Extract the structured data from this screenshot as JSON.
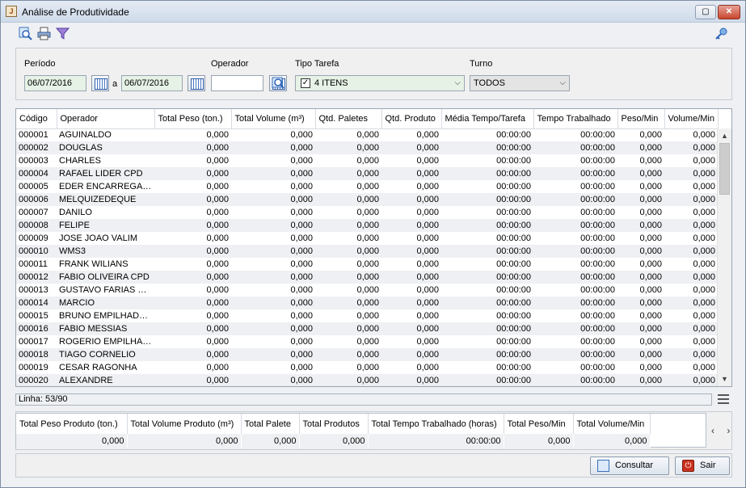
{
  "window": {
    "title": "Análise de Produtividade",
    "app_icon": "java-icon",
    "controls": {
      "maximize": "▢",
      "close": "✕"
    }
  },
  "toolbar": {
    "icons": [
      "search-report-icon",
      "print-icon",
      "filter-icon",
      "key-icon"
    ]
  },
  "filters": {
    "periodo_label": "Período",
    "date_from": "06/07/2016",
    "separator": "a",
    "date_to": "06/07/2016",
    "operador_label": "Operador",
    "operador_value": "",
    "tipo_tarefa_label": "Tipo Tarefa",
    "tipo_tarefa_value": "4 ITENS",
    "tipo_tarefa_checked": "✓",
    "turno_label": "Turno",
    "turno_value": "TODOS"
  },
  "grid": {
    "columns": [
      "Código",
      "Operador",
      "Total Peso (ton.)",
      "Total Volume (m³)",
      "Qtd. Paletes",
      "Qtd. Produto",
      "Média Tempo/Tarefa",
      "Tempo Trabalhado",
      "Peso/Min",
      "Volume/Min"
    ],
    "rows": [
      [
        "000001",
        "AGUINALDO",
        "0,000",
        "0,000",
        "0,000",
        "0,000",
        "00:00:00",
        "00:00:00",
        "0,000",
        "0,000"
      ],
      [
        "000002",
        "DOUGLAS",
        "0,000",
        "0,000",
        "0,000",
        "0,000",
        "00:00:00",
        "00:00:00",
        "0,000",
        "0,000"
      ],
      [
        "000003",
        "CHARLES",
        "0,000",
        "0,000",
        "0,000",
        "0,000",
        "00:00:00",
        "00:00:00",
        "0,000",
        "0,000"
      ],
      [
        "000004",
        "RAFAEL LIDER CPD",
        "0,000",
        "0,000",
        "0,000",
        "0,000",
        "00:00:00",
        "00:00:00",
        "0,000",
        "0,000"
      ],
      [
        "000005",
        "EDER ENCARREGADO",
        "0,000",
        "0,000",
        "0,000",
        "0,000",
        "00:00:00",
        "00:00:00",
        "0,000",
        "0,000"
      ],
      [
        "000006",
        "MELQUIZEDEQUE",
        "0,000",
        "0,000",
        "0,000",
        "0,000",
        "00:00:00",
        "00:00:00",
        "0,000",
        "0,000"
      ],
      [
        "000007",
        "DANILO",
        "0,000",
        "0,000",
        "0,000",
        "0,000",
        "00:00:00",
        "00:00:00",
        "0,000",
        "0,000"
      ],
      [
        "000008",
        "FELIPE",
        "0,000",
        "0,000",
        "0,000",
        "0,000",
        "00:00:00",
        "00:00:00",
        "0,000",
        "0,000"
      ],
      [
        "000009",
        "JOSE JOAO VALIM",
        "0,000",
        "0,000",
        "0,000",
        "0,000",
        "00:00:00",
        "00:00:00",
        "0,000",
        "0,000"
      ],
      [
        "000010",
        "WMS3",
        "0,000",
        "0,000",
        "0,000",
        "0,000",
        "00:00:00",
        "00:00:00",
        "0,000",
        "0,000"
      ],
      [
        "000011",
        "FRANK WILIANS",
        "0,000",
        "0,000",
        "0,000",
        "0,000",
        "00:00:00",
        "00:00:00",
        "0,000",
        "0,000"
      ],
      [
        "000012",
        "FABIO OLIVEIRA CPD",
        "0,000",
        "0,000",
        "0,000",
        "0,000",
        "00:00:00",
        "00:00:00",
        "0,000",
        "0,000"
      ],
      [
        "000013",
        "GUSTAVO FARIAS CPD",
        "0,000",
        "0,000",
        "0,000",
        "0,000",
        "00:00:00",
        "00:00:00",
        "0,000",
        "0,000"
      ],
      [
        "000014",
        "MARCIO",
        "0,000",
        "0,000",
        "0,000",
        "0,000",
        "00:00:00",
        "00:00:00",
        "0,000",
        "0,000"
      ],
      [
        "000015",
        "BRUNO EMPILHADEIR...",
        "0,000",
        "0,000",
        "0,000",
        "0,000",
        "00:00:00",
        "00:00:00",
        "0,000",
        "0,000"
      ],
      [
        "000016",
        "FABIO MESSIAS",
        "0,000",
        "0,000",
        "0,000",
        "0,000",
        "00:00:00",
        "00:00:00",
        "0,000",
        "0,000"
      ],
      [
        "000017",
        "ROGERIO EMPILHAD...",
        "0,000",
        "0,000",
        "0,000",
        "0,000",
        "00:00:00",
        "00:00:00",
        "0,000",
        "0,000"
      ],
      [
        "000018",
        "TIAGO CORNELIO",
        "0,000",
        "0,000",
        "0,000",
        "0,000",
        "00:00:00",
        "00:00:00",
        "0,000",
        "0,000"
      ],
      [
        "000019",
        "CESAR RAGONHA",
        "0,000",
        "0,000",
        "0,000",
        "0,000",
        "00:00:00",
        "00:00:00",
        "0,000",
        "0,000"
      ],
      [
        "000020",
        "ALEXANDRE",
        "0,000",
        "0,000",
        "0,000",
        "0,000",
        "00:00:00",
        "00:00:00",
        "0,000",
        "0,000"
      ]
    ],
    "scroll_up": "▲",
    "scroll_down": "▼"
  },
  "status": {
    "line_text": "Linha: 53/90"
  },
  "totals": {
    "columns": [
      "Total Peso Produto (ton.)",
      "Total Volume Produto (m³)",
      "Total Palete",
      "Total Produtos",
      "Total Tempo Trabalhado (horas)",
      "Total Peso/Min",
      "Total Volume/Min"
    ],
    "values": [
      "0,000",
      "0,000",
      "0,000",
      "0,000",
      "00:00:00",
      "0,000",
      "0,000"
    ],
    "nav": "‹ ›"
  },
  "buttons": {
    "consultar": "Consultar",
    "sair": "Sair"
  },
  "colors": {
    "date_field_bg": "#e6f2e6",
    "row_alt_bg": "#eef0f3",
    "exit_red": "#c9321e"
  }
}
